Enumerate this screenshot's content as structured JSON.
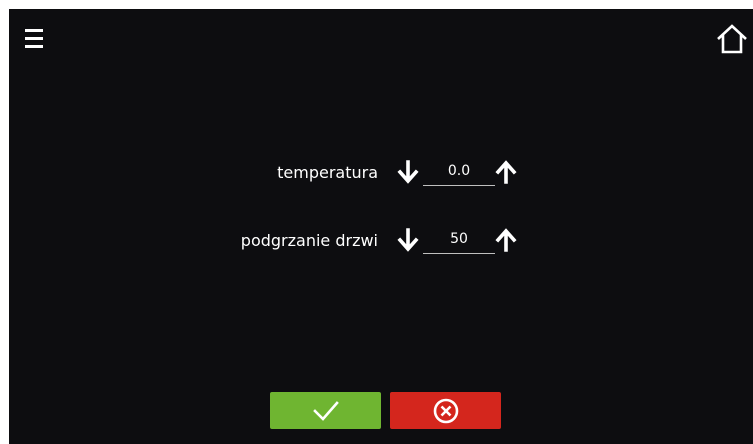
{
  "colors": {
    "background": "#0d0d10",
    "text": "#ffffff",
    "confirm": "#6fb531",
    "cancel": "#d4261d"
  },
  "header": {
    "menu_icon": "hamburger-icon",
    "home_icon": "home-icon"
  },
  "settings": [
    {
      "label": "temperatura",
      "value": "0.0",
      "down_icon": "arrow-down-icon",
      "up_icon": "arrow-up-icon"
    },
    {
      "label": "podgrzanie drzwi",
      "value": "50",
      "down_icon": "arrow-down-icon",
      "up_icon": "arrow-up-icon"
    }
  ],
  "footer": {
    "confirm_icon": "check-icon",
    "cancel_icon": "circle-x-icon"
  }
}
